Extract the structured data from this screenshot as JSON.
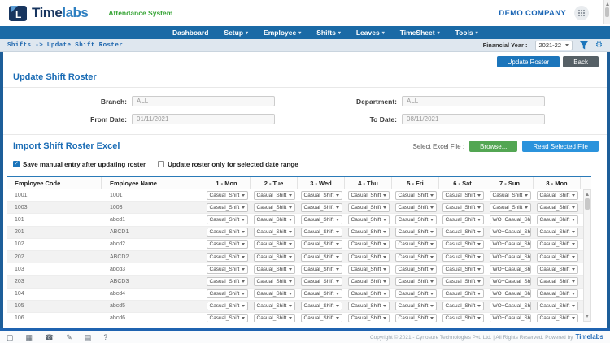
{
  "header": {
    "logo_time": "Time",
    "logo_labs": "labs",
    "subtitle": "Attendance System",
    "company": "DEMO COMPANY"
  },
  "nav": {
    "items": [
      {
        "label": "Dashboard",
        "has_dropdown": false
      },
      {
        "label": "Setup",
        "has_dropdown": true
      },
      {
        "label": "Employee",
        "has_dropdown": true
      },
      {
        "label": "Shifts",
        "has_dropdown": true
      },
      {
        "label": "Leaves",
        "has_dropdown": true
      },
      {
        "label": "TimeSheet",
        "has_dropdown": true
      },
      {
        "label": "Tools",
        "has_dropdown": true
      }
    ]
  },
  "breadcrumb": {
    "path": "Shifts -> Update Shift Roster",
    "financial_year_label": "Financial Year :",
    "financial_year_value": "2021-22"
  },
  "toolbar": {
    "update_roster": "Update Roster",
    "back": "Back"
  },
  "roster_form": {
    "title": "Update Shift Roster",
    "fields": [
      {
        "label": "Branch:",
        "value": "ALL"
      },
      {
        "label": "Department:",
        "value": "ALL"
      },
      {
        "label": "From Date:",
        "value": "01/11/2021"
      },
      {
        "label": "To Date:",
        "value": "08/11/2021"
      }
    ]
  },
  "import_section": {
    "title": "Import Shift Roster Excel",
    "select_label": "Select Excel File :",
    "browse": "Browse...",
    "read_file": "Read Selected File",
    "checkboxes": [
      {
        "label": "Save manual entry after updating roster",
        "checked": true
      },
      {
        "label": "Update roster only for selected date range",
        "checked": false
      }
    ]
  },
  "table": {
    "columns": [
      "Employee Code",
      "Employee Name",
      "1 - Mon",
      "2 - Tue",
      "3 - Wed",
      "4 - Thu",
      "5 - Fri",
      "6 - Sat",
      "7 - Sun",
      "8 - Mon"
    ],
    "rows": [
      {
        "code": "1001",
        "name": "1001",
        "shifts": [
          "Casual_Shift",
          "Casual_Shift",
          "Casual_Shift",
          "Casual_Shift",
          "Casual_Shift",
          "Casual_Shift",
          "Casual_Shift",
          "Casual_Shift"
        ]
      },
      {
        "code": "1003",
        "name": "1003",
        "shifts": [
          "Casual_Shift",
          "Casual_Shift",
          "Casual_Shift",
          "Casual_Shift",
          "Casual_Shift",
          "Casual_Shift",
          "Casual_Shift",
          "Casual_Shift"
        ]
      },
      {
        "code": "101",
        "name": "abcd1",
        "shifts": [
          "Casual_Shift",
          "Casual_Shift",
          "Casual_Shift",
          "Casual_Shift",
          "Casual_Shift",
          "Casual_Shift",
          "WO+Casual_Sh",
          "Casual_Shift"
        ]
      },
      {
        "code": "201",
        "name": "ABCD1",
        "shifts": [
          "Casual_Shift",
          "Casual_Shift",
          "Casual_Shift",
          "Casual_Shift",
          "Casual_Shift",
          "Casual_Shift",
          "WO+Casual_Sh",
          "Casual_Shift"
        ]
      },
      {
        "code": "102",
        "name": "abcd2",
        "shifts": [
          "Casual_Shift",
          "Casual_Shift",
          "Casual_Shift",
          "Casual_Shift",
          "Casual_Shift",
          "Casual_Shift",
          "WO+Casual_Sh",
          "Casual_Shift"
        ]
      },
      {
        "code": "202",
        "name": "ABCD2",
        "shifts": [
          "Casual_Shift",
          "Casual_Shift",
          "Casual_Shift",
          "Casual_Shift",
          "Casual_Shift",
          "Casual_Shift",
          "WO+Casual_Sh",
          "Casual_Shift"
        ]
      },
      {
        "code": "103",
        "name": "abcd3",
        "shifts": [
          "Casual_Shift",
          "Casual_Shift",
          "Casual_Shift",
          "Casual_Shift",
          "Casual_Shift",
          "Casual_Shift",
          "WO+Casual_Sh",
          "Casual_Shift"
        ]
      },
      {
        "code": "203",
        "name": "ABCD3",
        "shifts": [
          "Casual_Shift",
          "Casual_Shift",
          "Casual_Shift",
          "Casual_Shift",
          "Casual_Shift",
          "Casual_Shift",
          "WO+Casual_Sh",
          "Casual_Shift"
        ]
      },
      {
        "code": "104",
        "name": "abcd4",
        "shifts": [
          "Casual_Shift",
          "Casual_Shift",
          "Casual_Shift",
          "Casual_Shift",
          "Casual_Shift",
          "Casual_Shift",
          "WO+Casual_Sh",
          "Casual_Shift"
        ]
      },
      {
        "code": "105",
        "name": "abcd5",
        "shifts": [
          "Casual_Shift",
          "Casual_Shift",
          "Casual_Shift",
          "Casual_Shift",
          "Casual_Shift",
          "Casual_Shift",
          "WO+Casual_Sh",
          "Casual_Shift"
        ]
      },
      {
        "code": "106",
        "name": "abcd6",
        "shifts": [
          "Casual_Shift",
          "Casual_Shift",
          "Casual_Shift",
          "Casual_Shift",
          "Casual_Shift",
          "Casual_Shift",
          "WO+Casual_Sh",
          "Casual_Shift"
        ]
      }
    ]
  },
  "footer": {
    "icons": [
      {
        "name": "monitor-icon",
        "glyph": "▢"
      },
      {
        "name": "calculator-icon",
        "glyph": "▦"
      },
      {
        "name": "phone-icon",
        "glyph": "☎"
      },
      {
        "name": "edit-icon",
        "glyph": "✎"
      },
      {
        "name": "printer-icon",
        "glyph": "▤"
      },
      {
        "name": "help-icon",
        "glyph": "?"
      }
    ],
    "copyright": "Copyright © 2021 - Cynosure Technologies Pvt. Ltd. | All Rights Reserved. Powered by",
    "brand": "Timelabs"
  },
  "colors": {
    "brand_blue": "#1b66b5",
    "navbar_blue": "#1a6aa6",
    "accent_green": "#36a435",
    "button_blue": "#1b75bb",
    "button_gray": "#566066",
    "browse_green": "#53a653",
    "read_file_blue": "#2b93dc",
    "frame_blue": "#1d5e99"
  }
}
